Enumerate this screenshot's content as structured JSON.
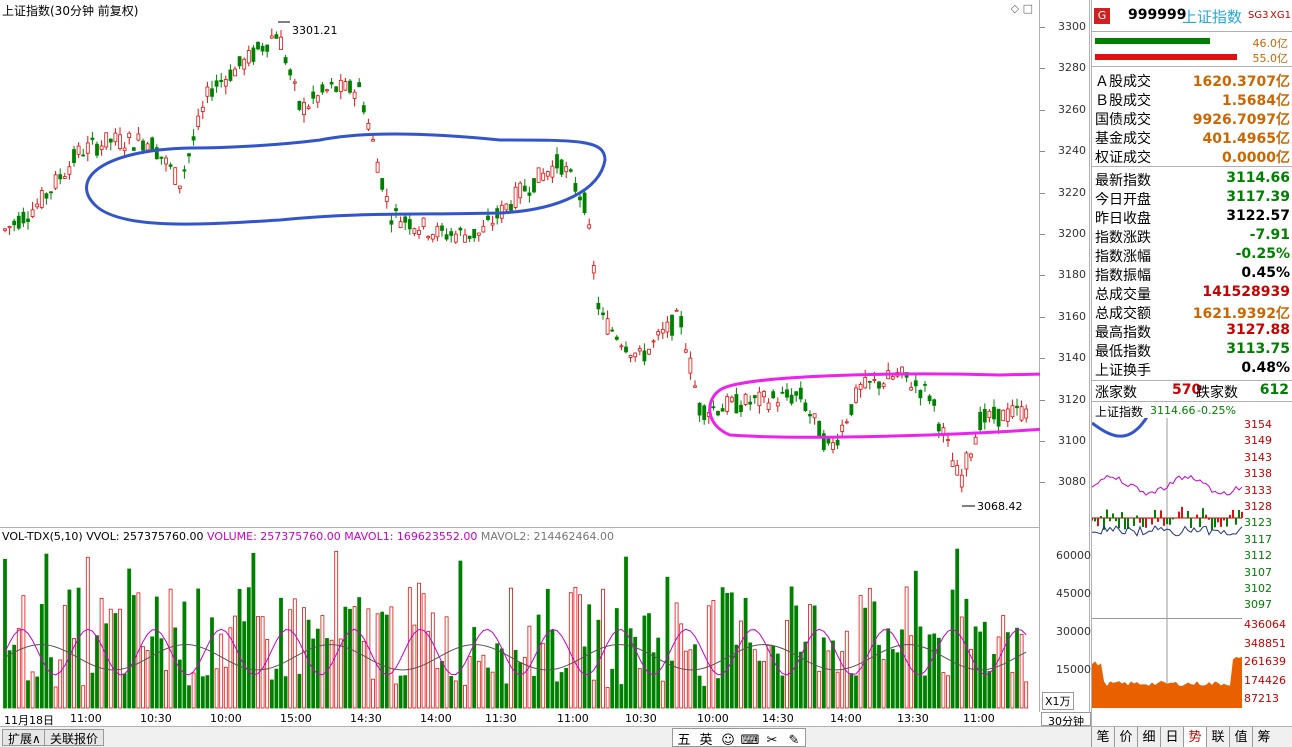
{
  "main": {
    "title": "上证指数(30分钟 前复权)",
    "price_ticks": [
      "3300",
      "3280",
      "3260",
      "3240",
      "3220",
      "3200",
      "3180",
      "3160",
      "3140",
      "3120",
      "3100",
      "3080"
    ],
    "high_label": "3301.21",
    "low_label": "3068.42"
  },
  "volume": {
    "indicator": "VOL-TDX(5,10)",
    "vvol": "VVOL: 257375760.00",
    "volume": "VOLUME: 257375760.00",
    "mavol1": "MAVOL1: 169623552.00",
    "mavol2": "MAVOL2: 214462464.00",
    "ticks": [
      "60000",
      "45000",
      "30000",
      "15000"
    ],
    "unit": "X1万"
  },
  "time_axis": {
    "labels": [
      "11月18日",
      "11:00",
      "10:30",
      "10:00",
      "15:00",
      "14:30",
      "14:00",
      "11:30",
      "11:00",
      "10:30",
      "10:00",
      "14:30",
      "14:00",
      "13:30",
      "11:00"
    ],
    "period": "30分钟"
  },
  "bottom_bar": {
    "expand": "扩展∧",
    "related": "关联报价",
    "tools": [
      "五",
      "英",
      "☺",
      "⌨",
      "✂",
      "✎"
    ],
    "right_tabs": [
      "笔",
      "价",
      "细",
      "日",
      "势",
      "联",
      "值",
      "筹"
    ]
  },
  "right_panel": {
    "badge": "G",
    "code": "999999",
    "name": "上证指数",
    "tags": [
      "SG3",
      "XG1"
    ],
    "bar1_value": "46.0亿",
    "bar2_value": "55.0亿",
    "trades": [
      {
        "label": "Ａ股成交",
        "value": "1620.3707亿"
      },
      {
        "label": "Ｂ股成交",
        "value": "1.5684亿"
      },
      {
        "label": "国债成交",
        "value": "9926.7097亿"
      },
      {
        "label": "基金成交",
        "value": "401.4965亿"
      },
      {
        "label": "权证成交",
        "value": "0.0000亿"
      }
    ],
    "stats": [
      {
        "label": "最新指数",
        "value": "3114.66",
        "color": "#008000"
      },
      {
        "label": "今日开盘",
        "value": "3117.39",
        "color": "#008000"
      },
      {
        "label": "昨日收盘",
        "value": "3122.57",
        "color": "#000000"
      },
      {
        "label": "指数涨跌",
        "value": "-7.91",
        "color": "#008000"
      },
      {
        "label": "指数涨幅",
        "value": "-0.25%",
        "color": "#008000"
      },
      {
        "label": "指数振幅",
        "value": "0.45%",
        "color": "#000000"
      },
      {
        "label": "总成交量",
        "value": "141528939",
        "color": "#cc0000"
      },
      {
        "label": "总成交额",
        "value": "1621.9392亿",
        "color": "#cc6600"
      },
      {
        "label": "最高指数",
        "value": "3127.88",
        "color": "#cc0000"
      },
      {
        "label": "最低指数",
        "value": "3113.75",
        "color": "#008000"
      },
      {
        "label": "上证换手",
        "value": "0.48%",
        "color": "#000000"
      }
    ],
    "up_label": "涨家数",
    "up_value": "570",
    "down_label": "跌家数",
    "down_value": "612",
    "mini_title": "上证指数",
    "mini_last": "3114.66",
    "mini_pct": "-0.25%",
    "mini_price_ticks": [
      "3154",
      "3149",
      "3143",
      "3138",
      "3133",
      "3128",
      "3123",
      "3117",
      "3112",
      "3107",
      "3102",
      "3097"
    ],
    "mini_vol_ticks": [
      "436064",
      "348851",
      "261639",
      "174426",
      "87213"
    ]
  },
  "colors": {
    "up": "#e01010",
    "down": "#008000",
    "ma1": "#cc00cc",
    "ma2": "#555555",
    "annot_blue": "#3355cc",
    "annot_magenta": "#ee22ee",
    "orange": "#e86000"
  }
}
